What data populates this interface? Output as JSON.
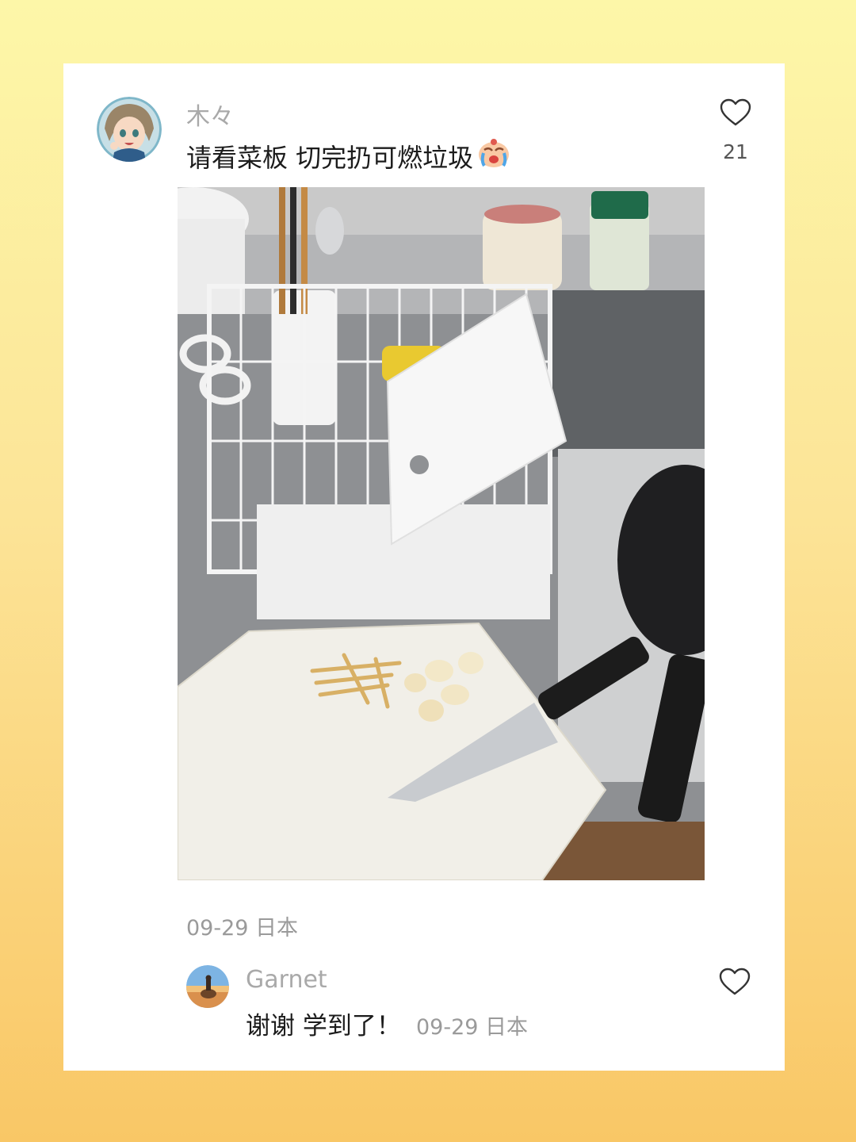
{
  "comment": {
    "username": "木々",
    "text": "请看菜板 切完扔可燃垃圾",
    "emoji_icon": "crying-face-emoji",
    "like_icon": "heart-outline-icon",
    "like_count": "21",
    "meta": "09-29 日本"
  },
  "reply": {
    "username": "Garnet",
    "text": "谢谢 学到了！",
    "meta": "09-29 日本",
    "like_icon": "heart-outline-icon"
  },
  "colors": {
    "background_top": "#fdf7a8",
    "background_bottom": "#f9c766",
    "card": "#ffffff",
    "muted_text": "#a9a9a9"
  }
}
